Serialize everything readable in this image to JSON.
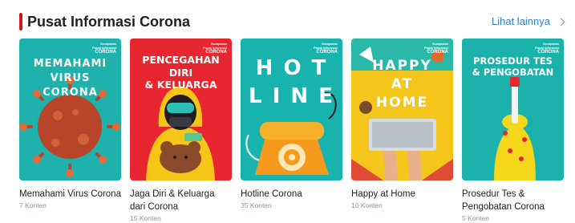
{
  "section": {
    "title": "Pusat Informasi Corona",
    "see_more_label": "Lihat lainnya",
    "accent_color": "#d0171e",
    "link_color": "#2b83c4"
  },
  "cards": [
    {
      "title": "Memahami Virus Corona",
      "count": "7 Konten",
      "cover_lines": [
        "MEMAHAMI",
        "VIRUS",
        "CORONA"
      ],
      "cover_bg": "#1fb1ac",
      "badge": [
        "Kumparan",
        "Pusat Informasi",
        "CORONA"
      ]
    },
    {
      "title": "Jaga Diri & Keluarga dari Corona",
      "count": "15 Konten",
      "cover_lines": [
        "PENCEGAHAN",
        "DIRI",
        "& KELUARGA"
      ],
      "cover_bg": "#e8262f",
      "badge": [
        "Kumparan",
        "Pusat Informasi",
        "CORONA"
      ]
    },
    {
      "title": "Hotline Corona",
      "count": "35 Konten",
      "cover_lines": [
        "H O T",
        "L I N E"
      ],
      "cover_bg": "#18b3ad",
      "badge": [
        "Kumparan",
        "Pusat Informasi",
        "CORONA"
      ]
    },
    {
      "title": "Happy at Home",
      "count": "10 Konten",
      "cover_lines": [
        "HAPPY",
        "AT",
        "HOME"
      ],
      "cover_bg": "#f4c51b",
      "badge": [
        "Kumparan",
        "Pusat Informasi",
        "CORONA"
      ]
    },
    {
      "title": "Prosedur Tes & Pengobatan Corona",
      "count": "5 Konten",
      "cover_lines": [
        "PROSEDUR TES",
        "& PENGOBATAN"
      ],
      "cover_bg": "#1bb2ac",
      "badge": [
        "Kumparan",
        "Pusat Informasi",
        "CORONA"
      ]
    }
  ]
}
